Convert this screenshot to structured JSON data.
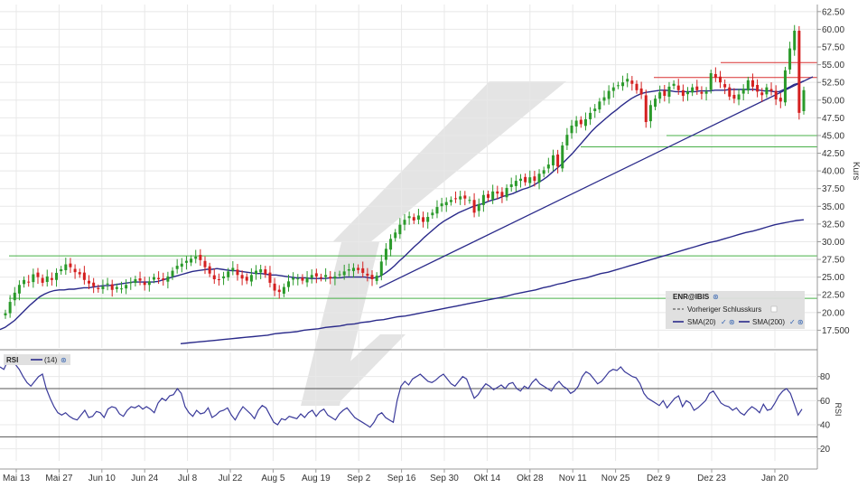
{
  "chart_data": [
    {
      "type": "candlestick",
      "ylabel": "Kurs",
      "ylim": [
        15.0,
        63.5
      ],
      "yticks": [
        "17.500",
        "20.00",
        "22.50",
        "25.00",
        "27.50",
        "30.00",
        "32.50",
        "35.00",
        "37.50",
        "40.00",
        "42.50",
        "45.00",
        "47.50",
        "50.00",
        "52.50",
        "55.00",
        "57.50",
        "60.00",
        "62.50"
      ],
      "xticks": [
        "Mai 13",
        "Mai 27",
        "Jun 10",
        "Jun 24",
        "Jul 8",
        "Jul 22",
        "Aug 5",
        "Aug 19",
        "Sep 2",
        "Sep 16",
        "Sep 30",
        "Okt 14",
        "Okt 28",
        "Nov 11",
        "Nov 25",
        "Dez 9",
        "Dez 23",
        "Jan 20"
      ],
      "legend": {
        "title": "ENR@IBIS",
        "prev_close": "Vorheriger Schlusskurs",
        "sma20": "SMA(20)",
        "sma200": "SMA(200)"
      },
      "close": [
        19.9,
        21.5,
        22.8,
        23.9,
        24.6,
        24.3,
        25.4,
        25.0,
        24.2,
        25.1,
        24.6,
        25.6,
        26.1,
        26.8,
        26.4,
        25.7,
        25.4,
        24.6,
        24.1,
        23.7,
        23.3,
        23.7,
        24.1,
        23.2,
        23.6,
        23.4,
        23.9,
        24.3,
        24.7,
        24.5,
        23.9,
        24.4,
        25.0,
        24.7,
        24.6,
        25.1,
        25.9,
        26.6,
        26.9,
        27.3,
        27.6,
        27.9,
        27.4,
        26.4,
        25.5,
        24.7,
        24.6,
        25.1,
        25.8,
        26.3,
        25.3,
        24.8,
        24.5,
        25.3,
        25.9,
        26.1,
        25.4,
        24.2,
        23.1,
        22.9,
        23.6,
        24.4,
        24.9,
        24.8,
        24.5,
        24.9,
        25.3,
        25.1,
        24.9,
        25.3,
        24.8,
        25.1,
        25.4,
        25.8,
        26.1,
        26.3,
        26.0,
        25.6,
        25.2,
        24.7,
        25.2,
        27.2,
        29.0,
        30.4,
        31.3,
        32.4,
        33.1,
        33.6,
        33.0,
        33.7,
        32.8,
        33.5,
        34.1,
        34.9,
        35.4,
        35.6,
        35.9,
        36.1,
        36.4,
        36.1,
        35.9,
        34.1,
        35.3,
        36.6,
        36.2,
        37.1,
        36.8,
        36.4,
        37.6,
        38.1,
        38.6,
        38.9,
        38.4,
        39.1,
        38.6,
        39.6,
        40.1,
        40.9,
        42.2,
        40.6,
        43.6,
        45.1,
        46.4,
        47.1,
        46.6,
        47.3,
        48.2,
        48.8,
        49.8,
        50.4,
        51.3,
        51.8,
        52.1,
        52.5,
        53.0,
        52.3,
        51.4,
        50.8,
        46.9,
        49.3,
        50.2,
        51.1,
        50.6,
        51.9,
        52.3,
        51.4,
        50.6,
        51.2,
        51.8,
        51.4,
        50.9,
        51.2,
        53.8,
        53.2,
        52.5,
        51.8,
        50.5,
        50.2,
        50.8,
        51.6,
        52.8,
        51.9,
        51.2,
        50.7,
        51.8,
        51.3,
        50.1,
        49.8,
        54.2,
        57.3,
        59.8,
        48.2,
        51.4
      ],
      "sma20": [
        17.6,
        17.9,
        18.4,
        18.9,
        19.6,
        20.3,
        21.0,
        21.6,
        22.2,
        22.6,
        22.9,
        23.1,
        23.2,
        23.2,
        23.3,
        23.3,
        23.4,
        23.5,
        23.5,
        23.6,
        23.7,
        23.8,
        23.8,
        23.9,
        24.0,
        24.1,
        24.2,
        24.3,
        24.3,
        24.3,
        24.3,
        24.3,
        24.4,
        24.6,
        24.8,
        25.0,
        25.2,
        25.4,
        25.6,
        25.8,
        25.9,
        26.0,
        26.1,
        26.1,
        26.2,
        26.1,
        26.0,
        25.9,
        25.9,
        25.8,
        25.7,
        25.6,
        25.5,
        25.5,
        25.4,
        25.3,
        25.3,
        25.2,
        25.1,
        25.0,
        24.9,
        24.9,
        24.9,
        24.8,
        24.8,
        24.8,
        24.8,
        24.9,
        24.9,
        24.9,
        25.0,
        25.0,
        25.0,
        25.0,
        25.0,
        24.9,
        24.9,
        25.1,
        25.5,
        26.0,
        26.6,
        27.3,
        27.9,
        28.6,
        29.3,
        29.9,
        30.6,
        31.2,
        31.8,
        32.4,
        32.9,
        33.3,
        33.7,
        34.1,
        34.4,
        34.7,
        35.0,
        35.2,
        35.4,
        35.7,
        35.9,
        36.1,
        36.4,
        36.6,
        36.8,
        37.1,
        37.4,
        37.6,
        37.9,
        38.3,
        38.7,
        39.2,
        39.8,
        40.4,
        41.0,
        41.7,
        42.4,
        43.2,
        44.0,
        44.8,
        45.6,
        46.3,
        46.9,
        47.5,
        48.1,
        48.6,
        49.2,
        49.7,
        50.2,
        50.6,
        50.9,
        51.1,
        51.2,
        51.3,
        51.4,
        51.4,
        51.3,
        51.2,
        51.2,
        51.2,
        51.2,
        51.2,
        51.3,
        51.3,
        51.3,
        51.4,
        51.4,
        51.4,
        51.5,
        51.5,
        51.5,
        51.5,
        51.5,
        51.5,
        51.4,
        51.3,
        51.3,
        51.2,
        51.2,
        51.5,
        51.8,
        52.2,
        52.4,
        52.7
      ],
      "sma200": [
        15.6,
        15.7,
        15.8,
        15.9,
        16.0,
        16.1,
        16.2,
        16.3,
        16.4,
        16.5,
        16.6,
        16.7,
        16.8,
        17.0,
        17.1,
        17.2,
        17.3,
        17.5,
        17.6,
        17.7,
        17.9,
        18.0,
        18.1,
        18.3,
        18.4,
        18.6,
        18.7,
        18.9,
        19.0,
        19.2,
        19.4,
        19.5,
        19.7,
        19.9,
        20.1,
        20.3,
        20.5,
        20.7,
        20.9,
        21.1,
        21.3,
        21.5,
        21.7,
        21.9,
        22.1,
        22.3,
        22.6,
        22.8,
        23.0,
        23.2,
        23.5,
        23.7,
        24.0,
        24.2,
        24.5,
        24.7,
        24.9,
        25.2,
        25.5,
        25.7,
        26.0,
        26.3,
        26.6,
        26.9,
        27.2,
        27.5,
        27.8,
        28.1,
        28.4,
        28.7,
        29.0,
        29.3,
        29.6,
        29.9,
        30.1,
        30.4,
        30.7,
        31.0,
        31.3,
        31.5,
        31.8,
        32.1,
        32.4,
        32.6,
        32.8,
        33.0,
        33.1
      ],
      "annotations": {
        "support_lines": [
          28.0,
          22.0,
          43.4,
          45.0
        ],
        "resistance_lines": [
          53.2,
          55.3
        ]
      }
    },
    {
      "type": "line",
      "title": "RSI",
      "series": [
        {
          "name": "(14)"
        }
      ],
      "ylim": [
        10,
        100
      ],
      "yticks": [
        "20",
        "40",
        "60",
        "80"
      ],
      "levels": [
        70,
        30
      ],
      "rsi": [
        88,
        86,
        93,
        92,
        90,
        86,
        80,
        75,
        72,
        76,
        80,
        82,
        70,
        62,
        55,
        50,
        48,
        50,
        47,
        45,
        44,
        48,
        52,
        46,
        47,
        51,
        50,
        46,
        53,
        55,
        54,
        49,
        47,
        52,
        55,
        54,
        56,
        53,
        55,
        53,
        50,
        58,
        62,
        60,
        64,
        65,
        70,
        66,
        55,
        50,
        47,
        52,
        49,
        50,
        54,
        46,
        48,
        51,
        52,
        54,
        48,
        44,
        50,
        55,
        52,
        49,
        45,
        52,
        56,
        54,
        48,
        42,
        40,
        45,
        44,
        47,
        46,
        45,
        49,
        46,
        50,
        52,
        47,
        51,
        53,
        48,
        46,
        44,
        49,
        52,
        54,
        50,
        46,
        44,
        42,
        40,
        38,
        42,
        48,
        50,
        46,
        44,
        42,
        60,
        72,
        76,
        73,
        78,
        80,
        82,
        79,
        76,
        75,
        77,
        80,
        82,
        78,
        74,
        72,
        76,
        80,
        78,
        70,
        62,
        65,
        70,
        74,
        72,
        69,
        71,
        73,
        70,
        74,
        75,
        70,
        68,
        72,
        70,
        75,
        78,
        74,
        72,
        70,
        68,
        73,
        76,
        72,
        70,
        66,
        68,
        72,
        80,
        84,
        82,
        78,
        74,
        76,
        80,
        84,
        86,
        85,
        88,
        84,
        82,
        80,
        79,
        74,
        66,
        62,
        60,
        58,
        56,
        60,
        54,
        58,
        62,
        64,
        55,
        60,
        58,
        52,
        54,
        57,
        60,
        66,
        68,
        63,
        58,
        56,
        55,
        52,
        54,
        50,
        48,
        52,
        55,
        53,
        50,
        57,
        52,
        53,
        58,
        64,
        68,
        70,
        66,
        57,
        48,
        53
      ]
    }
  ]
}
